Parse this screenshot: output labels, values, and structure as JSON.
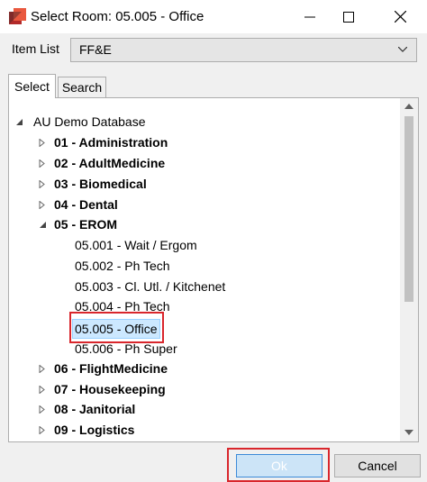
{
  "window": {
    "title": "Select Room: 05.005 - Office",
    "accent_red": "#d9262c"
  },
  "item_list": {
    "label": "Item List",
    "value": "FF&E"
  },
  "tabs": [
    {
      "label": "Select",
      "active": true
    },
    {
      "label": "Search",
      "active": false
    }
  ],
  "tree": {
    "root": "AU Demo Database",
    "nodes": [
      {
        "label": "01 - Administration",
        "level": 1,
        "expanded": false
      },
      {
        "label": "02 - AdultMedicine",
        "level": 1,
        "expanded": false
      },
      {
        "label": "03 - Biomedical",
        "level": 1,
        "expanded": false
      },
      {
        "label": "04 - Dental",
        "level": 1,
        "expanded": false
      },
      {
        "label": "05 - EROM",
        "level": 1,
        "expanded": true
      },
      {
        "label": "05.001 - Wait / Ergom",
        "level": 2
      },
      {
        "label": "05.002 - Ph Tech",
        "level": 2
      },
      {
        "label": "05.003 - Cl. Utl. / Kitchenet",
        "level": 2
      },
      {
        "label": "05.004 - Ph Tech",
        "level": 2
      },
      {
        "label": "05.005 - Office",
        "level": 2,
        "selected": true
      },
      {
        "label": "05.006 - Ph Super",
        "level": 2
      },
      {
        "label": "06 - FlightMedicine",
        "level": 1,
        "expanded": false
      },
      {
        "label": "07 - Housekeeping",
        "level": 1,
        "expanded": false
      },
      {
        "label": "08 - Janitorial",
        "level": 1,
        "expanded": false
      },
      {
        "label": "09 - Logistics",
        "level": 1,
        "expanded": false
      }
    ]
  },
  "buttons": {
    "ok": "Ok",
    "cancel": "Cancel"
  }
}
